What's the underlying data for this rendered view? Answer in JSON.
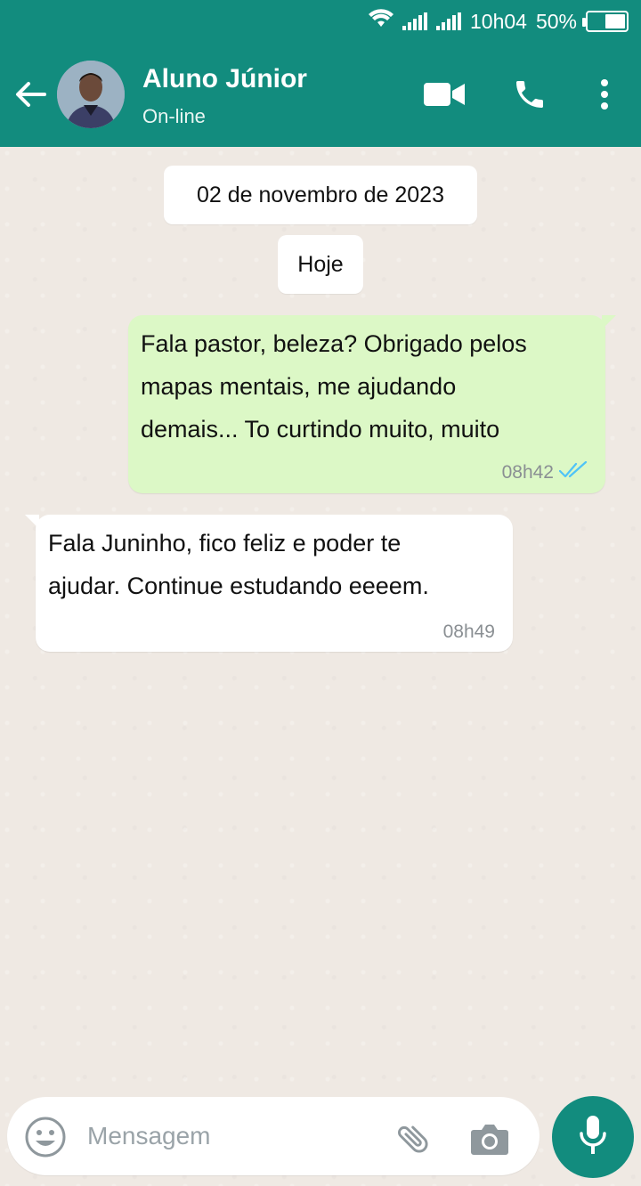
{
  "status_bar": {
    "time": "10h04",
    "battery": "50%"
  },
  "header": {
    "contact_name": "Aluno Júnior",
    "contact_status": "On-line"
  },
  "date_chip": "02 de novembro de 2023",
  "today_chip": "Hoje",
  "messages": [
    {
      "direction": "outgoing",
      "text": " Fala pastor, beleza? Obrigado pelos\nmapas mentais, me ajudando\ndemais... To curtindo muito, muito",
      "time": "08h42",
      "read": true
    },
    {
      "direction": "incoming",
      "text": " Fala Juninho, fico feliz e poder te\najudar. Continue estudando eeeem.",
      "time": "08h49"
    }
  ],
  "composer": {
    "placeholder": "Mensagem"
  },
  "colors": {
    "header": "#128c7e",
    "outgoing_bubble": "#dcf8c6",
    "incoming_bubble": "#ffffff",
    "read_ticks": "#4fc3f7",
    "chat_background": "#efe9e3"
  }
}
